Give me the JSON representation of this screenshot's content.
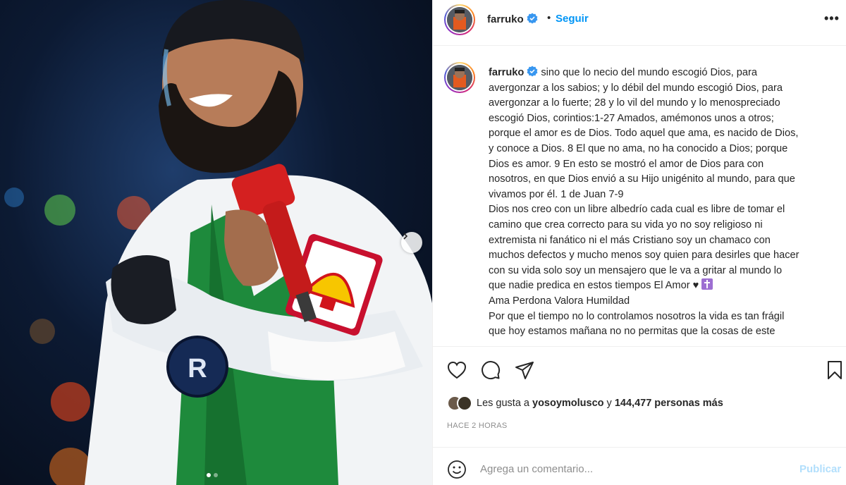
{
  "post": {
    "username": "farruko",
    "follow_label": "Seguir",
    "separator": "•",
    "more_label": "•••"
  },
  "caption": {
    "username": "farruko",
    "lines": [
      "sino que lo necio del mundo escogió Dios, para",
      "avergonzar a los sabios; y lo débil del mundo escogió Dios, para",
      "avergonzar a lo fuerte; 28 y lo vil del mundo y lo menospreciado",
      "escogió Dios, corintios:1-27 Amados, amémonos unos a otros;",
      "porque el amor es de Dios. Todo aquel que ama, es nacido de Dios,",
      "y conoce a Dios. 8 El que no ama, no ha conocido a Dios; porque",
      "Dios es amor. 9 En esto se mostró el amor de Dios para con",
      "nosotros, en que Dios envió a su Hijo unigénito al mundo, para que",
      "vivamos por él. 1 de Juan 7-9",
      "Dios nos creo con un libre albedrío cada cual es libre de tomar el",
      "camino que crea correcto para su vida yo no soy religioso ni",
      "extremista ni fanático ni el más Cristiano soy un chamaco con",
      "muchos defectos y mucho menos soy quien para desirles que hacer",
      "con su vida solo soy un mensajero que le va a gritar al mundo lo",
      "que nadie predica en estos tiempos El Amor ♥",
      "Ama Perdona Valora Humildad",
      "Por que el tiempo no lo controlamos nosotros la vida es tan frágil",
      "que hoy estamos mañana no no permitas que la cosas de este"
    ]
  },
  "likes": {
    "prefix": "Les gusta a ",
    "user": "yosoymolusco",
    "middle": " y ",
    "count": "144,477 personas más"
  },
  "timestamp": "HACE 2 HORAS",
  "comment": {
    "placeholder": "Agrega un comentario...",
    "publish_label": "Publicar"
  },
  "carousel": {
    "current": 1,
    "total": 2
  },
  "colors": {
    "accent": "#0095f6",
    "publish_disabled": "#b2dffc",
    "verified": "#3897f0"
  },
  "icons": [
    "verified-badge-icon",
    "more-options-icon",
    "heart-icon",
    "comment-icon",
    "share-icon",
    "bookmark-icon",
    "emoji-icon",
    "chevron-right-icon",
    "cross-emoji-icon"
  ]
}
